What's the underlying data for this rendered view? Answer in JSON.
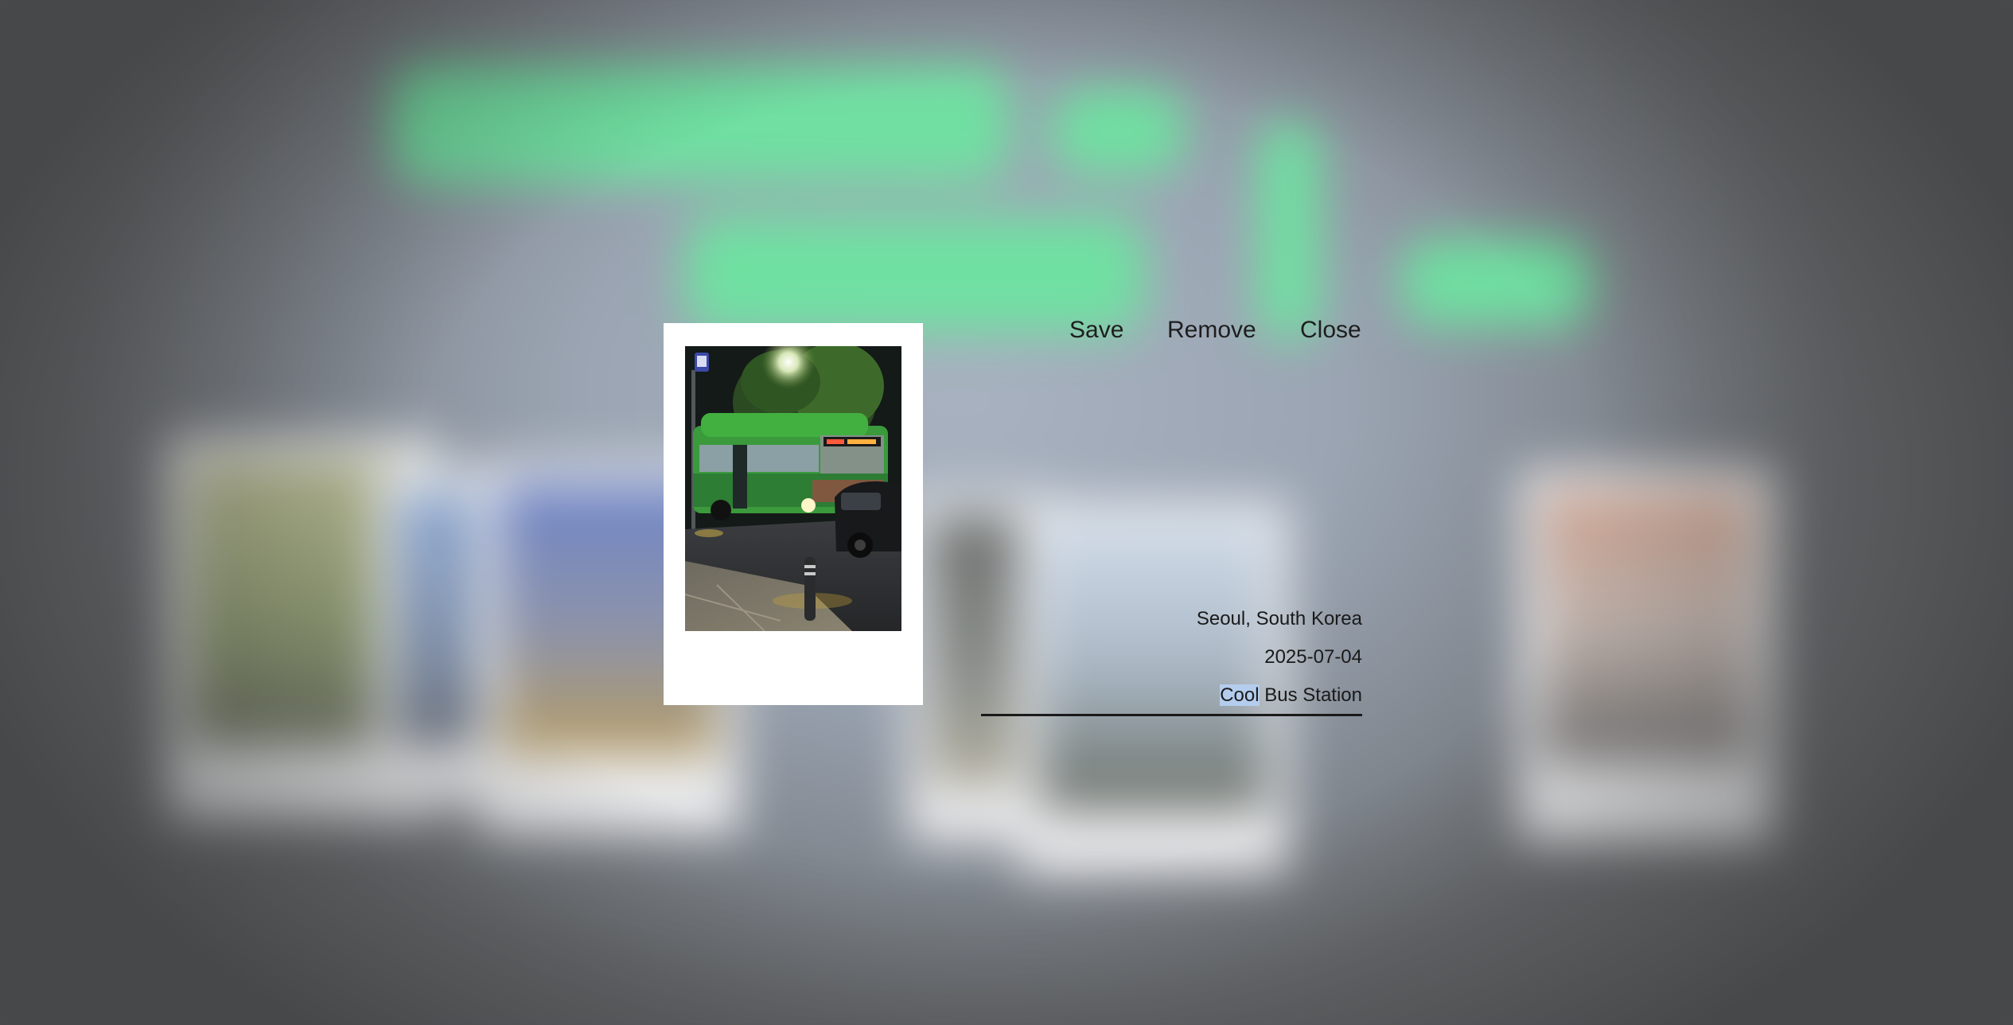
{
  "actions": {
    "save": "Save",
    "remove": "Remove",
    "close": "Close"
  },
  "entry": {
    "location": "Seoul, South Korea",
    "date": "2025-07-04",
    "caption_selected": "Cool",
    "caption_rest": " Bus Station"
  },
  "colors": {
    "backdrop_glow": "#6ee3a0",
    "caption_selection": "#b4cdee",
    "text": "#1a1a1a"
  }
}
